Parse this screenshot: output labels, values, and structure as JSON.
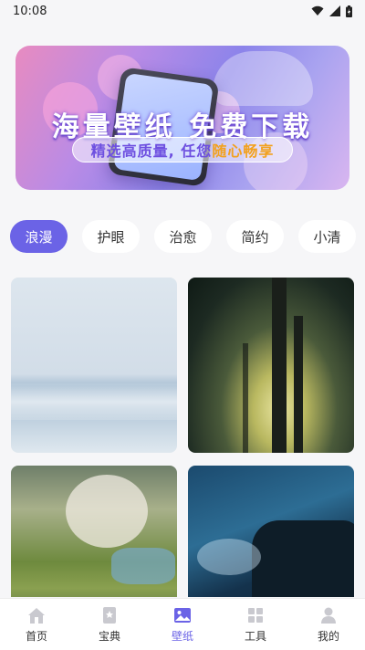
{
  "status_bar": {
    "time": "10:08"
  },
  "banner": {
    "title": "海量壁纸 免费下载",
    "subtitle_part1": "精选高质量, 任您",
    "subtitle_highlight": "随心畅享"
  },
  "categories": {
    "items": [
      {
        "label": "浪漫",
        "active": true
      },
      {
        "label": "护眼",
        "active": false
      },
      {
        "label": "治愈",
        "active": false
      },
      {
        "label": "简约",
        "active": false
      },
      {
        "label": "小清",
        "active": false
      }
    ]
  },
  "wallpapers": [
    {
      "name": "sea-horizon"
    },
    {
      "name": "forest-sunlight"
    },
    {
      "name": "cherry-blossom-terraces"
    },
    {
      "name": "ocean-waves-rocks"
    }
  ],
  "bottom_nav": {
    "items": [
      {
        "label": "首页",
        "icon": "home-icon",
        "active": false
      },
      {
        "label": "宝典",
        "icon": "book-icon",
        "active": false
      },
      {
        "label": "壁纸",
        "icon": "image-icon",
        "active": true
      },
      {
        "label": "工具",
        "icon": "grid-icon",
        "active": false
      },
      {
        "label": "我的",
        "icon": "person-icon",
        "active": false
      }
    ]
  },
  "colors": {
    "accent": "#6b63e6",
    "background": "#f6f6f8"
  }
}
